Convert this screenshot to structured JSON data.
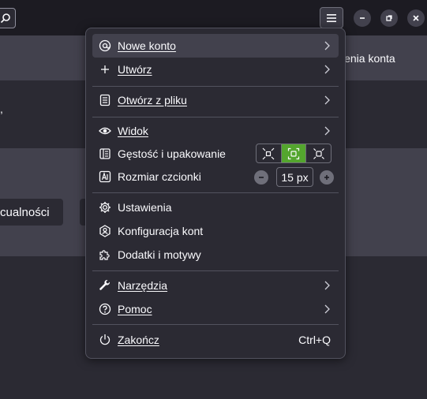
{
  "background": {
    "banner_text": "ienia konta",
    "left_text": ",",
    "news_button_label": "cualności"
  },
  "menu": {
    "items": {
      "new_account": {
        "label": "Nowe konto",
        "icon": "new-account-icon",
        "submenu": true
      },
      "create": {
        "label": "Utwórz",
        "icon": "plus-icon",
        "submenu": true
      },
      "open_file": {
        "label": "Otwórz z pliku",
        "icon": "file-icon",
        "submenu": true
      },
      "view": {
        "label": "Widok",
        "icon": "eye-icon",
        "submenu": true
      },
      "density": {
        "label": "Gęstość i upakowanie",
        "icon": "density-icon",
        "options": [
          "compact",
          "normal",
          "touch"
        ],
        "selected": "normal"
      },
      "font_size": {
        "label": "Rozmiar czcionki",
        "icon": "font-size-icon",
        "value": "15 px"
      },
      "settings": {
        "label": "Ustawienia",
        "icon": "gear-icon"
      },
      "account_settings": {
        "label": "Konfiguracja kont",
        "icon": "account-settings-icon"
      },
      "addons": {
        "label": "Dodatki i motywy",
        "icon": "puzzle-icon"
      },
      "tools": {
        "label": "Narzędzia",
        "icon": "wrench-icon",
        "submenu": true
      },
      "help": {
        "label": "Pomoc",
        "icon": "help-icon",
        "submenu": true
      },
      "quit": {
        "label": "Zakończ",
        "icon": "power-icon",
        "shortcut": "Ctrl+Q"
      }
    }
  },
  "colors": {
    "accent_selected": "#54a62e",
    "menu_bg": "#2b2a33",
    "titlebar_bg": "#1c1b22"
  }
}
